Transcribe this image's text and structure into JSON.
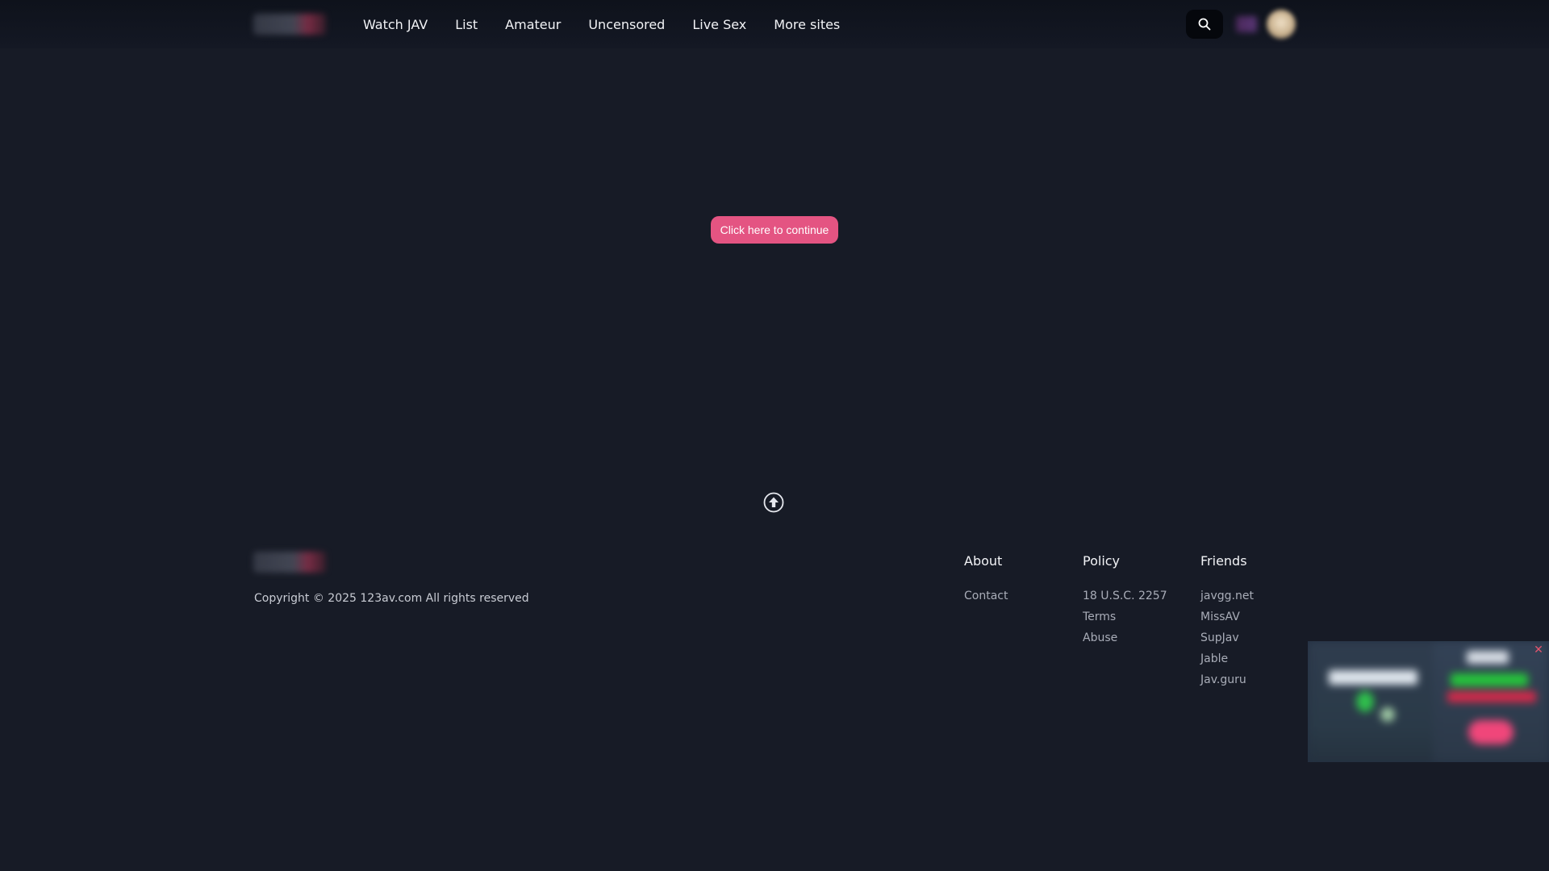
{
  "nav": {
    "items": [
      {
        "label": "Watch JAV"
      },
      {
        "label": "List"
      },
      {
        "label": "Amateur"
      },
      {
        "label": "Uncensored"
      },
      {
        "label": "Live Sex"
      },
      {
        "label": "More sites"
      }
    ]
  },
  "icons": {
    "search": "search-icon",
    "scroll_top": "arrow-up-circle-icon",
    "close": "close-icon"
  },
  "main": {
    "continue_label": "Click here to continue"
  },
  "footer": {
    "copyright": "Copyright © 2025 123av.com All rights reserved",
    "columns": [
      {
        "title": "About",
        "links": [
          "Contact"
        ]
      },
      {
        "title": "Policy",
        "links": [
          "18 U.S.C. 2257",
          "Terms",
          "Abuse"
        ]
      },
      {
        "title": "Friends",
        "links": [
          "javgg.net",
          "MissAV",
          "SupJav",
          "Jable",
          "Jav.guru"
        ]
      }
    ]
  },
  "ad": {
    "close_label": "✕"
  },
  "colors": {
    "background": "#171b26",
    "accent": "#e45482",
    "header": "#0e121b"
  }
}
